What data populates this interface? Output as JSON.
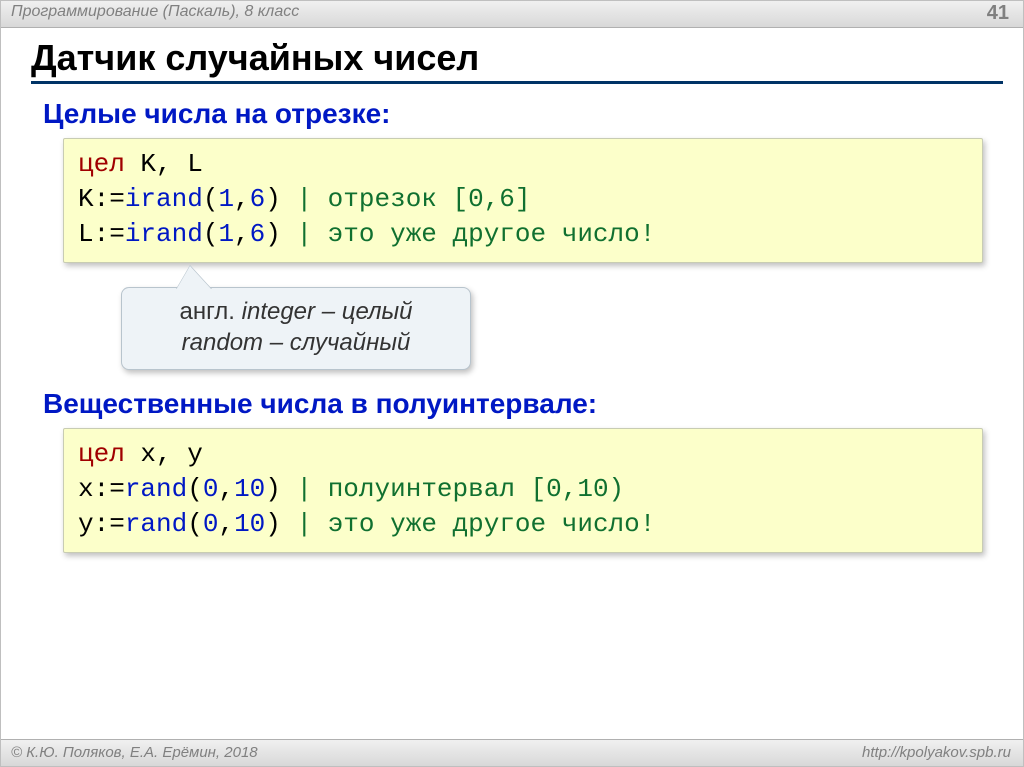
{
  "header": {
    "breadcrumb": "Программирование (Паскаль), 8 класс",
    "page": "41"
  },
  "title": "Датчик случайных чисел",
  "sec1": {
    "label": "Целые числа на отрезке:",
    "code": {
      "kw": "цел",
      "decl": " K, L",
      "l2a": "K:=",
      "fn": "irand",
      "open": "(",
      "n1": "1",
      "comma": ",",
      "n6": "6",
      "close": ")",
      "c2": " | отрезок [0,6]",
      "l3a": "L:=",
      "c3": " | это уже другое число!"
    }
  },
  "note": {
    "l1a": "англ. ",
    "l1b": "integer",
    "l1c": " – целый",
    "l2a": "random",
    "l2b": " – случайный"
  },
  "sec2": {
    "label": "Вещественные числа в полуинтервале:",
    "code": {
      "kw": "цел",
      "decl": " x, y",
      "l2a": "x:=",
      "fn": "rand",
      "open": "(",
      "n0": "0",
      "comma": ",",
      "n10": "10",
      "close": ")",
      "c2": " | полуинтервал [0,10)",
      "l3a": "y:=",
      "c3": " | это уже другое число!"
    }
  },
  "footer": {
    "copyright": "© К.Ю. Поляков, Е.А. Ерёмин, 2018",
    "site": "http://kpolyakov.spb.ru"
  }
}
